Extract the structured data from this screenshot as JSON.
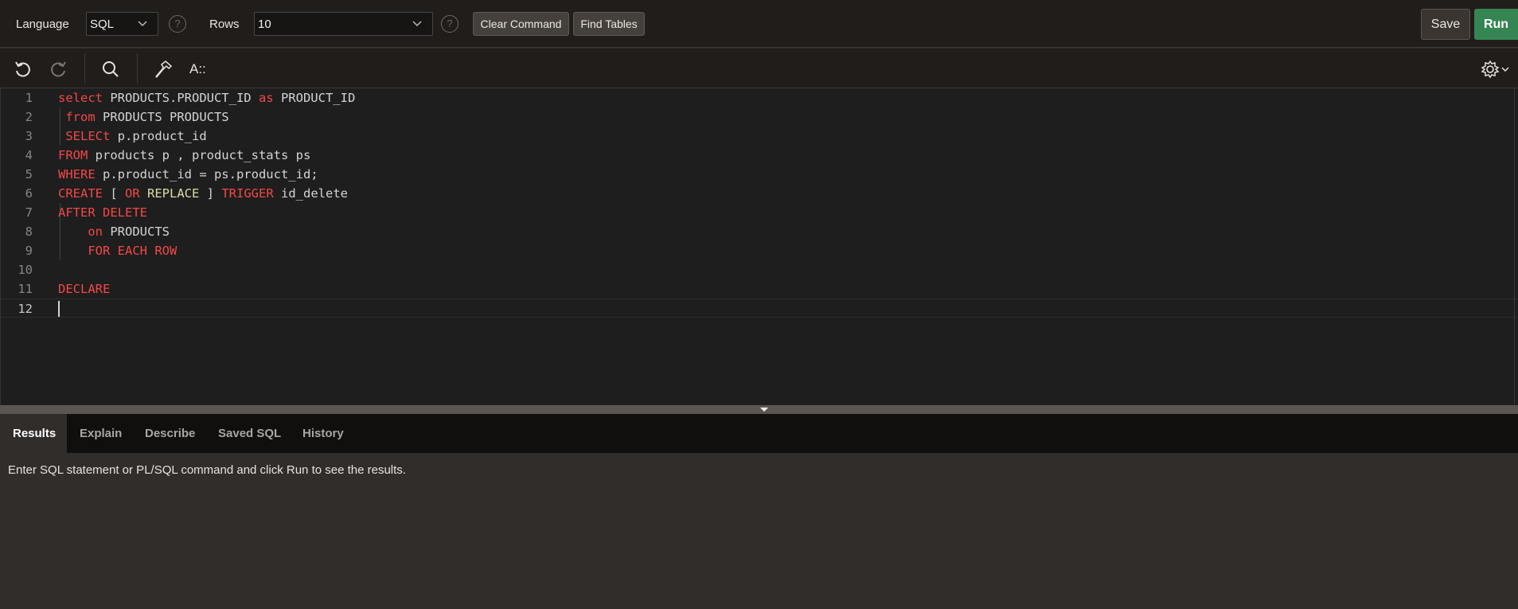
{
  "toolbar": {
    "language_label": "Language",
    "language_value": "SQL",
    "rows_label": "Rows",
    "rows_value": "10",
    "help_glyph": "?",
    "clear_command": "Clear Command",
    "find_tables": "Find Tables",
    "save": "Save",
    "run": "Run"
  },
  "editor_toolbar": {
    "icons": [
      "undo-icon",
      "redo-icon",
      "search-icon",
      "hammer-icon",
      "format-icon",
      "gear-icon"
    ],
    "format_glyph": "A::"
  },
  "editor": {
    "lines": [
      {
        "n": "1",
        "parts": [
          {
            "t": "select",
            "c": "kw"
          },
          {
            "t": " PRODUCTS.PRODUCT_ID ",
            "c": ""
          },
          {
            "t": "as",
            "c": "kw"
          },
          {
            "t": " PRODUCT_ID",
            "c": ""
          }
        ]
      },
      {
        "n": "2",
        "parts": [
          {
            "t": " ",
            "c": ""
          },
          {
            "t": "from",
            "c": "kw"
          },
          {
            "t": " PRODUCTS PRODUCTS",
            "c": ""
          }
        ]
      },
      {
        "n": "3",
        "parts": [
          {
            "t": " ",
            "c": ""
          },
          {
            "t": "SELECt",
            "c": "kw"
          },
          {
            "t": " p.product_id",
            "c": ""
          }
        ]
      },
      {
        "n": "4",
        "parts": [
          {
            "t": "FROM",
            "c": "kw"
          },
          {
            "t": " products p , product_stats ps",
            "c": ""
          }
        ]
      },
      {
        "n": "5",
        "parts": [
          {
            "t": "WHERE",
            "c": "kw"
          },
          {
            "t": " p.product_id = ps.product_id;",
            "c": ""
          }
        ]
      },
      {
        "n": "6",
        "parts": [
          {
            "t": "CREATE",
            "c": "kw"
          },
          {
            "t": " [ ",
            "c": ""
          },
          {
            "t": "OR",
            "c": "kw"
          },
          {
            "t": " ",
            "c": ""
          },
          {
            "t": "REPLACE",
            "c": "lit"
          },
          {
            "t": " ] ",
            "c": ""
          },
          {
            "t": "TRIGGER",
            "c": "kw"
          },
          {
            "t": " id_delete",
            "c": ""
          }
        ]
      },
      {
        "n": "7",
        "parts": [
          {
            "t": "AFTER DELETE",
            "c": "kw"
          }
        ]
      },
      {
        "n": "8",
        "parts": [
          {
            "t": "    ",
            "c": ""
          },
          {
            "t": "on",
            "c": "kw"
          },
          {
            "t": " PRODUCTS",
            "c": ""
          }
        ]
      },
      {
        "n": "9",
        "parts": [
          {
            "t": "    ",
            "c": ""
          },
          {
            "t": "FOR EACH ROW",
            "c": "kw"
          }
        ]
      },
      {
        "n": "10",
        "parts": []
      },
      {
        "n": "11",
        "parts": [
          {
            "t": "DECLARE",
            "c": "kw"
          }
        ]
      },
      {
        "n": "12",
        "parts": []
      }
    ],
    "current_line": 12
  },
  "tabs": [
    {
      "label": "Results",
      "active": true
    },
    {
      "label": "Explain",
      "active": false
    },
    {
      "label": "Describe",
      "active": false
    },
    {
      "label": "Saved SQL",
      "active": false
    },
    {
      "label": "History",
      "active": false
    }
  ],
  "results": {
    "message": "Enter SQL statement or PL/SQL command and click Run to see the results."
  },
  "colors": {
    "run_button": "#358553",
    "keyword": "#f44747",
    "literal": "#dcdcaa",
    "editor_bg": "#1e1e1e"
  }
}
